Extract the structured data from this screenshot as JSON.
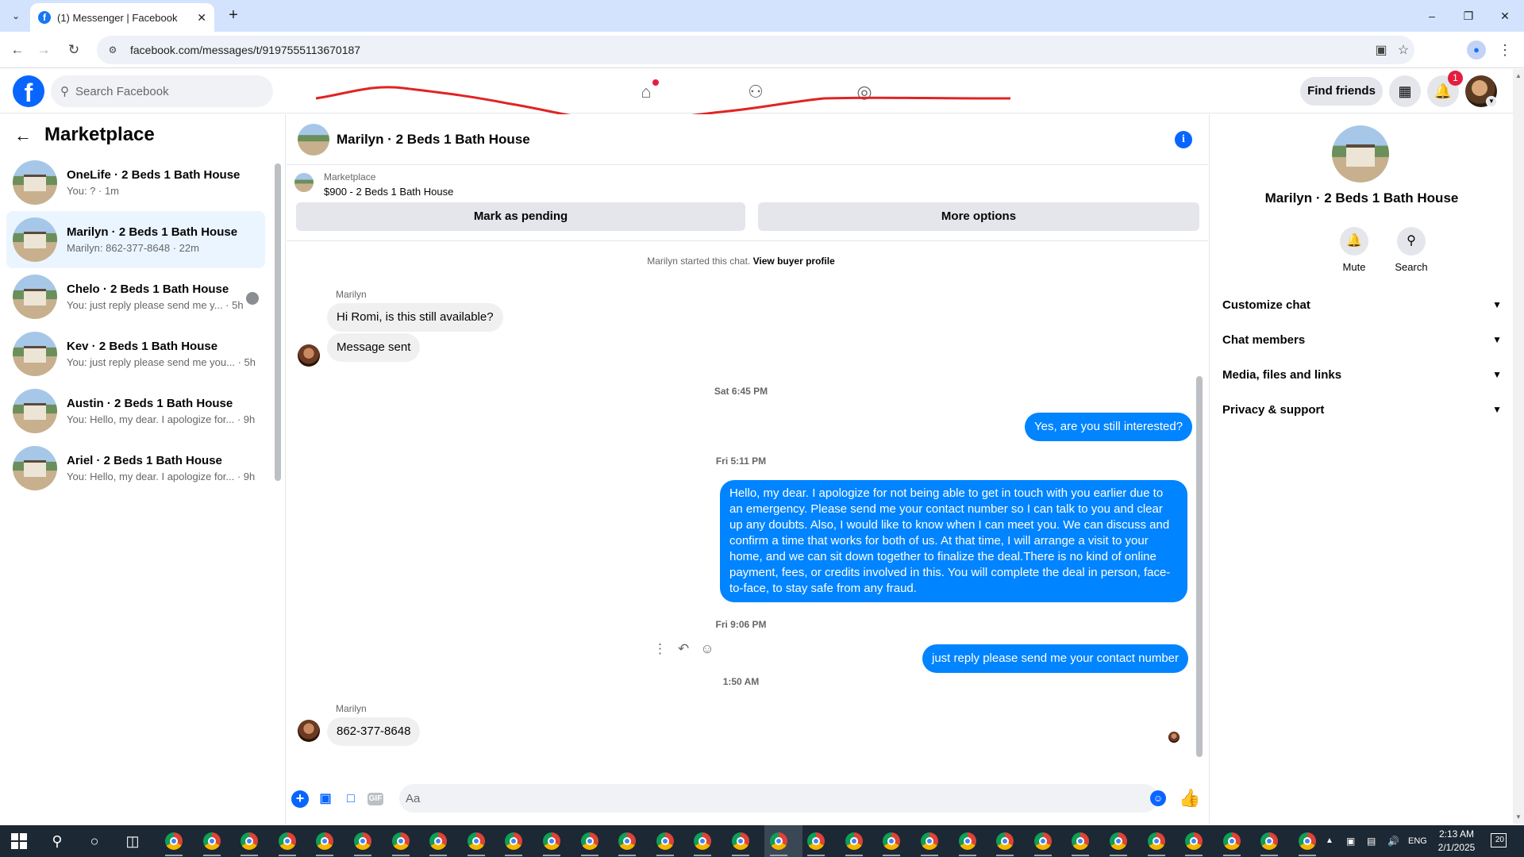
{
  "browser": {
    "tab_title": "(1) Messenger | Facebook",
    "url": "facebook.com/messages/t/9197555113670187"
  },
  "header": {
    "search_placeholder": "Search Facebook",
    "find_friends_label": "Find friends",
    "notification_count": "1"
  },
  "sidebar": {
    "title": "Marketplace",
    "conversations": [
      {
        "name": "OneLife · 2 Beds 1 Bath House",
        "preview": "You: ? · 1m"
      },
      {
        "name": "Marilyn · 2 Beds 1 Bath House",
        "preview": "Marilyn: 862-377-8648 · 22m"
      },
      {
        "name": "Chelo · 2 Beds 1 Bath House",
        "preview": "You: just reply please send me y... · 5h"
      },
      {
        "name": "Kev · 2 Beds 1 Bath House",
        "preview": "You: just reply please send me you... · 5h"
      },
      {
        "name": "Austin · 2 Beds 1 Bath House",
        "preview": "You: Hello, my dear. I apologize for... · 9h"
      },
      {
        "name": "Ariel · 2 Beds 1 Bath House",
        "preview": "You: Hello, my dear. I apologize for... · 9h"
      }
    ]
  },
  "chat": {
    "title": "Marilyn · 2 Beds 1 Bath House",
    "marketplace_label": "Marketplace",
    "listing": "$900 - 2 Beds 1 Bath House",
    "mark_pending_label": "Mark as pending",
    "more_options_label": "More options",
    "started_note": "Marilyn started this chat.",
    "view_buyer_profile": "View buyer profile",
    "sender": "Marilyn",
    "msg_1": "Hi Romi, is this still available?",
    "msg_2": "Message sent",
    "time_1": "Sat 6:45 PM",
    "msg_3": "Yes, are you still interested?",
    "time_2": "Fri 5:11 PM",
    "msg_4": "Hello, my dear. I apologize for not being able to get in touch with you earlier due to an emergency. Please send me your contact number so I can talk to you and clear up any doubts. Also, I would like to know when I can meet you. We can discuss and confirm a time that works for both of us. At that time, I will arrange a visit to your home, and we can sit down together to finalize the deal.There is no kind of online payment, fees, or credits involved in this. You will complete the deal in person, face-to-face, to stay safe from any fraud.",
    "time_3": "Fri 9:06 PM",
    "msg_5": "just reply please send me your contact number",
    "time_4": "1:50 AM",
    "msg_6": "862-377-8648",
    "composer_placeholder": "Aa"
  },
  "right_panel": {
    "name": "Marilyn · 2 Beds 1 Bath House",
    "mute_label": "Mute",
    "search_label": "Search",
    "sections": [
      "Customize chat",
      "Chat members",
      "Media, files and links",
      "Privacy & support"
    ]
  },
  "taskbar": {
    "language": "ENG",
    "time": "2:13 AM",
    "date": "2/1/2025",
    "notification_count": "20"
  },
  "colors": {
    "fb_blue": "#0866ff",
    "outgoing_bubble": "#0084ff",
    "incoming_bubble": "#f0f0f0",
    "active_conversation": "#ebf5ff",
    "scribble": "#e02424"
  }
}
